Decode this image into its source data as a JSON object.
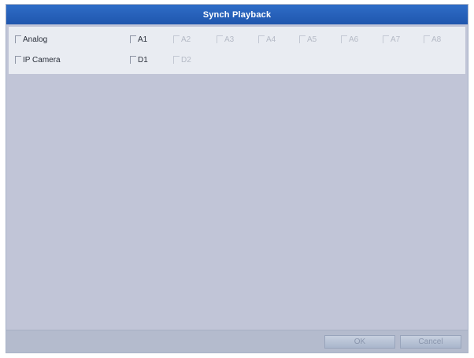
{
  "dialog": {
    "title": "Synch Playback",
    "title_bar_color": "#2663bc",
    "background_color": "#c1c5d7"
  },
  "analog": {
    "label": "Analog",
    "checked": false,
    "channels": [
      {
        "label": "A1",
        "enabled": true,
        "checked": false
      },
      {
        "label": "A2",
        "enabled": false,
        "checked": false
      },
      {
        "label": "A3",
        "enabled": false,
        "checked": false
      },
      {
        "label": "A4",
        "enabled": false,
        "checked": false
      },
      {
        "label": "A5",
        "enabled": false,
        "checked": false
      },
      {
        "label": "A6",
        "enabled": false,
        "checked": false
      },
      {
        "label": "A7",
        "enabled": false,
        "checked": false
      },
      {
        "label": "A8",
        "enabled": false,
        "checked": false
      }
    ]
  },
  "ip_camera": {
    "label": "IP Camera",
    "checked": false,
    "channels": [
      {
        "label": "D1",
        "enabled": true,
        "checked": false
      },
      {
        "label": "D2",
        "enabled": false,
        "checked": false
      }
    ]
  },
  "buttons": {
    "ok_label": "OK",
    "cancel_label": "Cancel"
  }
}
